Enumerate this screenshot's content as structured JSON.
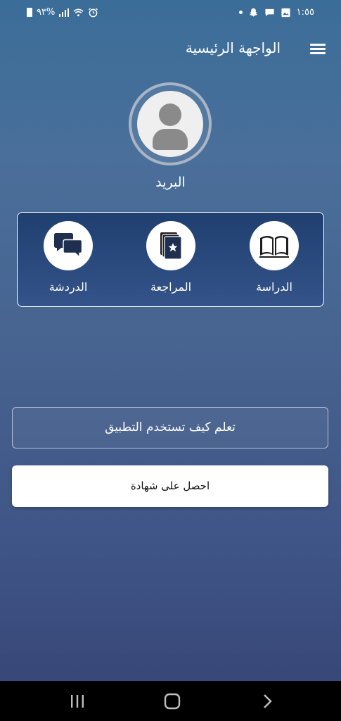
{
  "status_bar": {
    "time": "١:٥٥",
    "battery": "٩٣%"
  },
  "header": {
    "title": "الواجهة الرئيسية"
  },
  "profile": {
    "name": "البريد"
  },
  "features": [
    {
      "label": "الدراسة",
      "icon": "open-book-icon"
    },
    {
      "label": "المراجعة",
      "icon": "review-cards-icon"
    },
    {
      "label": "الدردشة",
      "icon": "chat-bubbles-icon"
    }
  ],
  "buttons": {
    "howto": "تعلم كيف تستخدم التطبيق",
    "certificate": "احصل على شهادة"
  },
  "colors": {
    "background_top": "#3b6d99",
    "background_bottom": "#354573",
    "panel": "#1f3f70",
    "card_bg": "#ffffff"
  }
}
